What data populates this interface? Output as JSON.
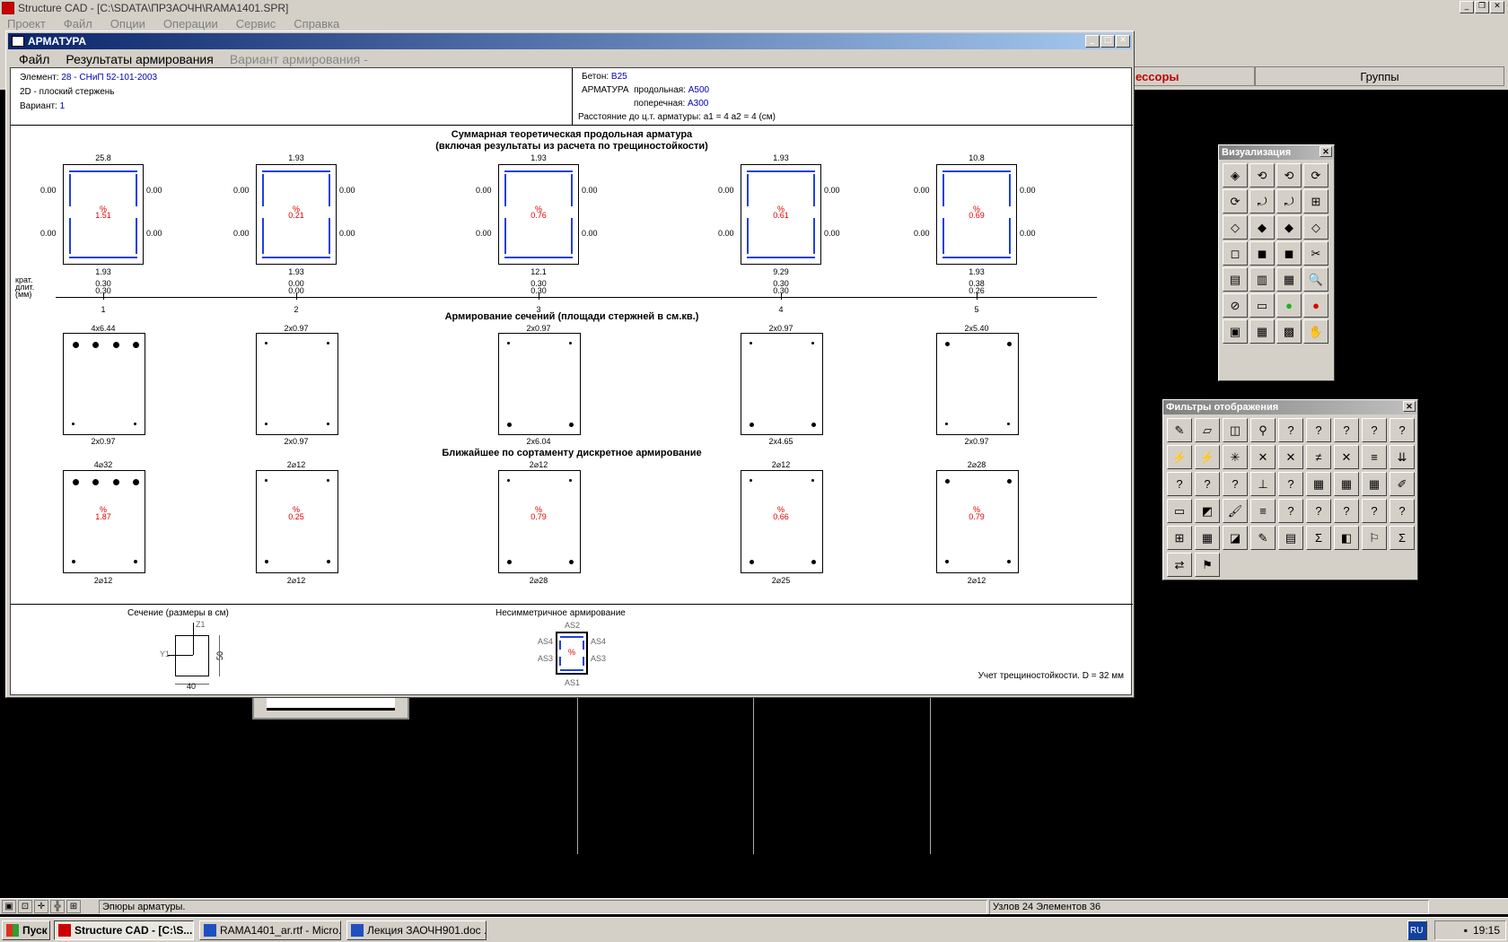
{
  "app": {
    "title": "Structure CAD  - [C:\\SDATA\\ПРЗАОЧН\\RAMA1401.SPR]",
    "menu": [
      "Проект",
      "Файл",
      "Опции",
      "Операции",
      "Сервис",
      "Справка"
    ],
    "tabs": {
      "processors": "ессоры",
      "groups": "Группы"
    }
  },
  "dialog": {
    "title": "АРМАТУРА",
    "menu": {
      "file": "Файл",
      "results": "Результаты армирования",
      "variant": "Вариант армирования -"
    },
    "header": {
      "element_label": "Элемент:",
      "element_value": "28 - СНиП 52-101-2003",
      "type": "2D - плоский стержень",
      "variant_label": "Вариант:",
      "variant_value": "1",
      "concrete_label": "Бетон:",
      "concrete_value": "B25",
      "rebar_label": "АРМАТУРА",
      "long_label": "продольная:",
      "long_value": "A500",
      "trans_label": "поперечная:",
      "trans_value": "A300",
      "distance": "Расстояние до ц.т. арматуры: а1 = 4  а2 = 4 (см)"
    },
    "section1_title_1": "Суммарная теоретическая продольная арматура",
    "section1_title_2": "(включая результаты из расчета по трещиностойкости)",
    "section2_title": "Армирование сечений (площади стержней в см.кв.)",
    "section3_title": "Ближайшее по сортаменту дискретное армирование",
    "crack_labels": {
      "l1": "крат.",
      "l2": "длит.",
      "l3": "(мм)"
    },
    "pct_symbol": "%",
    "sections": [
      {
        "num": "1",
        "top": "25.8",
        "bottom": "1.93",
        "side": "0.00",
        "pct": "1.51",
        "crack1": "0.30",
        "crack2": "0.30",
        "ar_top": "4x6.44",
        "ar_bot": "2x0.97",
        "disc_top": "4⌀32",
        "disc_bot": "2⌀12",
        "disc_pct": "1.87"
      },
      {
        "num": "2",
        "top": "1.93",
        "bottom": "1.93",
        "side": "0.00",
        "pct": "0.21",
        "crack1": "0.00",
        "crack2": "0.00",
        "ar_top": "2x0.97",
        "ar_bot": "2x0.97",
        "disc_top": "2⌀12",
        "disc_bot": "2⌀12",
        "disc_pct": "0.25"
      },
      {
        "num": "3",
        "top": "1.93",
        "bottom": "12.1",
        "side": "0.00",
        "pct": "0.76",
        "crack1": "0.30",
        "crack2": "0.30",
        "ar_top": "2x0.97",
        "ar_bot": "2x6.04",
        "disc_top": "2⌀12",
        "disc_bot": "2⌀28",
        "disc_pct": "0.79"
      },
      {
        "num": "4",
        "top": "1.93",
        "bottom": "9.29",
        "side": "0.00",
        "pct": "0.61",
        "crack1": "0.30",
        "crack2": "0.30",
        "ar_top": "2x0.97",
        "ar_bot": "2x4.65",
        "disc_top": "2⌀12",
        "disc_bot": "2⌀25",
        "disc_pct": "0.66"
      },
      {
        "num": "5",
        "top": "10.8",
        "bottom": "1.93",
        "side": "0.00",
        "pct": "0.69",
        "crack1": "0.38",
        "crack2": "0.26",
        "ar_top": "2x5.40",
        "ar_bot": "2x0.97",
        "disc_top": "2⌀28",
        "disc_bot": "2⌀12",
        "disc_pct": "0.79"
      }
    ],
    "legend": {
      "section_title": "Сечение (размеры в см)",
      "z1": "Z1",
      "y1": "Y1",
      "height": "50",
      "width": "40",
      "asym_title": "Несимметричное армирование",
      "as1": "AS1",
      "as2": "AS2",
      "as3": "AS3",
      "as4": "AS4",
      "crack_note": "Учет трещиностойкости. D = 32 мм"
    }
  },
  "palettes": {
    "vis_title": "Визуализация",
    "filter_title": "Фильтры отображения"
  },
  "status": {
    "message": "Эпюры арматуры.",
    "counts": "Узлов 24 Элементов 36"
  },
  "taskbar": {
    "start": "Пуск",
    "items": [
      "Structure CAD - [C:\\S...",
      "RAMA1401_ar.rtf - Micro...",
      "Лекция ЗАОЧН901.doc ..."
    ],
    "lang": "RU",
    "clock": "19:15"
  }
}
